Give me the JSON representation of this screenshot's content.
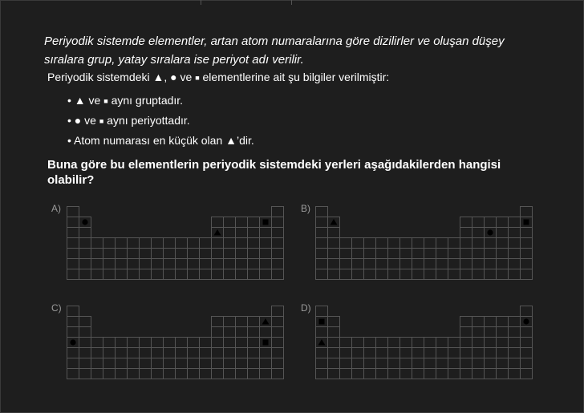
{
  "intro": {
    "line1": "Periyodik sistemde elementler, artan atom numaralarına göre dizilirler ve oluşan düşey",
    "line2": "sıralara grup, yatay sıralara ise periyot adı verilir."
  },
  "given": {
    "prefix": "Periyodik sistemdeki",
    "triangle": "▲",
    "comma": ",",
    "circle": "●",
    "ve": "ve",
    "square": "■",
    "suffix": "elementlerine ait şu bilgiler verilmiştir:"
  },
  "bullets": [
    {
      "bullet": "•",
      "text1": "▲ ve",
      "sym": "■",
      "text2": "aynı gruptadır."
    },
    {
      "bullet": "•",
      "text1": "● ve",
      "sym": "■",
      "text2": "aynı periyottadır."
    },
    {
      "bullet": "•",
      "text1": "Atom numarası en küçük olan ▲’dir.",
      "sym": "",
      "text2": ""
    }
  ],
  "question": {
    "line1": "Buna göre bu elementlerin periyodik sistemdeki yerleri aşağıdakilerden hangisi",
    "line2": "olabilir?"
  },
  "options": [
    {
      "label": "A)",
      "marks": [
        {
          "shape": "circle",
          "row": 2,
          "col": 2
        },
        {
          "shape": "triangle",
          "row": 3,
          "col": 13
        },
        {
          "shape": "square",
          "row": 2,
          "col": 17
        }
      ]
    },
    {
      "label": "B)",
      "marks": [
        {
          "shape": "triangle",
          "row": 2,
          "col": 2
        },
        {
          "shape": "circle",
          "row": 3,
          "col": 15
        },
        {
          "shape": "square",
          "row": 2,
          "col": 18
        }
      ]
    },
    {
      "label": "C)",
      "marks": [
        {
          "shape": "triangle",
          "row": 2,
          "col": 17
        },
        {
          "shape": "circle",
          "row": 4,
          "col": 1
        },
        {
          "shape": "square",
          "row": 4,
          "col": 17
        }
      ]
    },
    {
      "label": "D)",
      "marks": [
        {
          "shape": "square",
          "row": 2,
          "col": 1
        },
        {
          "shape": "circle",
          "row": 2,
          "col": 18
        },
        {
          "shape": "triangle",
          "row": 4,
          "col": 1
        }
      ]
    }
  ],
  "colors": {
    "background": "#1e1e1e",
    "text": "#ffffff",
    "grid_line": "#555555",
    "option_label": "#9a9a9a",
    "mark": "#000000"
  }
}
